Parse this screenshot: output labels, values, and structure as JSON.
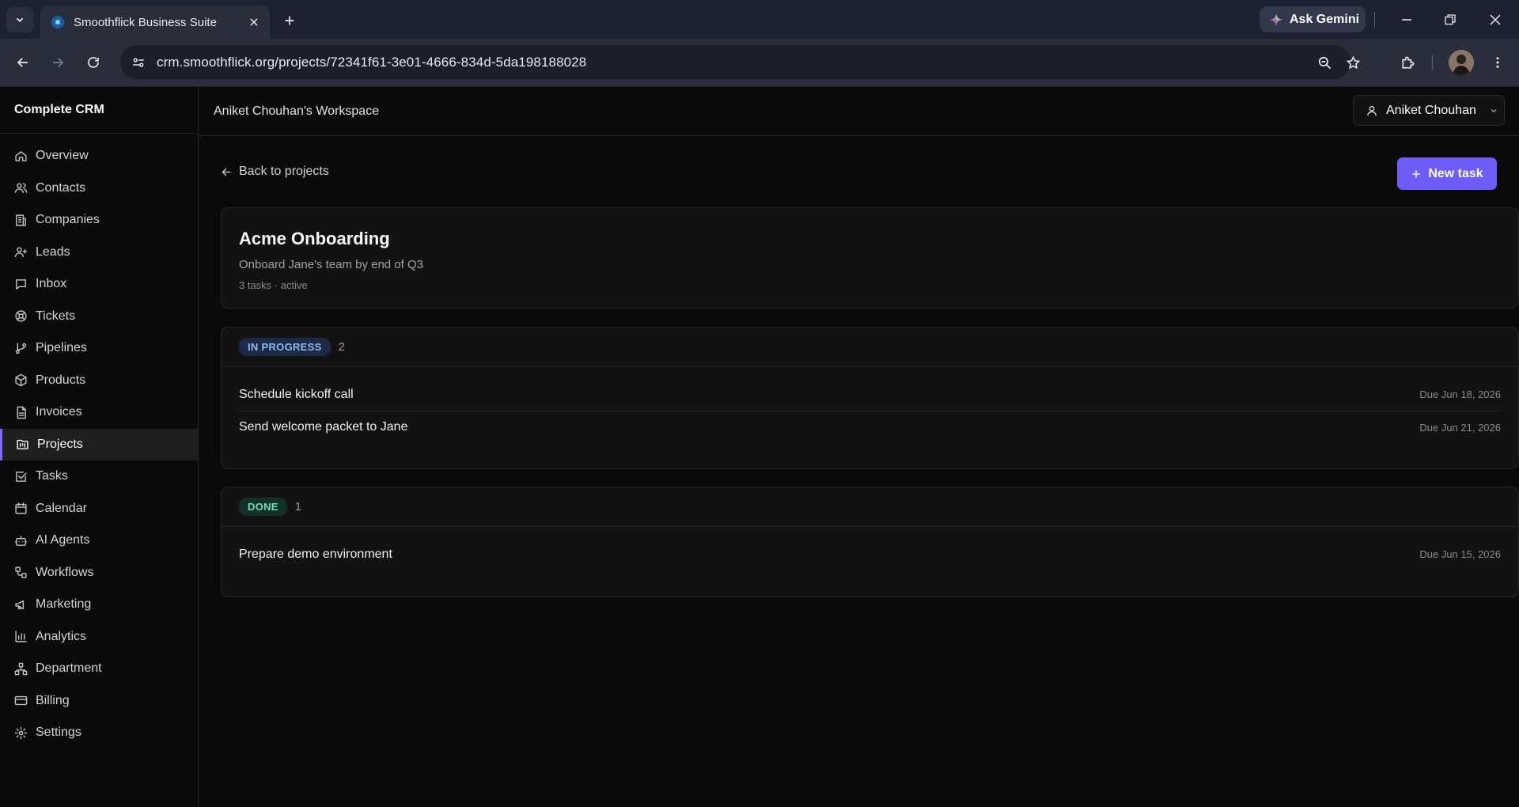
{
  "browser": {
    "tab_title": "Smoothflick Business Suite",
    "ask_gemini": "Ask Gemini",
    "url_host": "crm.smoothflick.org",
    "url_path": "/projects/72341f61-3e01-4666-834d-5da198188028"
  },
  "app": {
    "brand": "Complete CRM",
    "workspace": "Aniket Chouhan's Workspace",
    "user_name": "Aniket Chouhan",
    "accent": "#6d5df6"
  },
  "sidebar": {
    "items": [
      {
        "label": "Overview",
        "icon": "home-icon"
      },
      {
        "label": "Contacts",
        "icon": "users-icon"
      },
      {
        "label": "Companies",
        "icon": "building-icon"
      },
      {
        "label": "Leads",
        "icon": "user-plus-icon"
      },
      {
        "label": "Inbox",
        "icon": "message-icon"
      },
      {
        "label": "Tickets",
        "icon": "lifebuoy-icon"
      },
      {
        "label": "Pipelines",
        "icon": "git-branch-icon"
      },
      {
        "label": "Products",
        "icon": "package-icon"
      },
      {
        "label": "Invoices",
        "icon": "file-text-icon"
      },
      {
        "label": "Projects",
        "icon": "folder-kanban-icon",
        "active": true
      },
      {
        "label": "Tasks",
        "icon": "check-square-icon"
      },
      {
        "label": "Calendar",
        "icon": "calendar-icon"
      },
      {
        "label": "AI Agents",
        "icon": "bot-icon"
      },
      {
        "label": "Workflows",
        "icon": "workflow-icon"
      },
      {
        "label": "Marketing",
        "icon": "megaphone-icon"
      },
      {
        "label": "Analytics",
        "icon": "bar-chart-icon"
      },
      {
        "label": "Department",
        "icon": "network-icon"
      },
      {
        "label": "Billing",
        "icon": "credit-card-icon"
      },
      {
        "label": "Settings",
        "icon": "gear-icon"
      }
    ]
  },
  "page": {
    "back_label": "Back to projects",
    "new_task_label": "New task",
    "project_title": "Acme Onboarding",
    "project_desc": "Onboard Jane's team by end of Q3",
    "project_meta": "3 tasks · active"
  },
  "groups": {
    "in_progress": {
      "label": "IN PROGRESS",
      "count": "2",
      "tasks": [
        {
          "title": "Schedule kickoff call",
          "due": "Due Jun 18, 2026"
        },
        {
          "title": "Send welcome packet to Jane",
          "due": "Due Jun 21, 2026"
        }
      ]
    },
    "done": {
      "label": "DONE",
      "count": "1",
      "tasks": [
        {
          "title": "Prepare demo environment",
          "due": "Due Jun 15, 2026"
        }
      ]
    }
  }
}
